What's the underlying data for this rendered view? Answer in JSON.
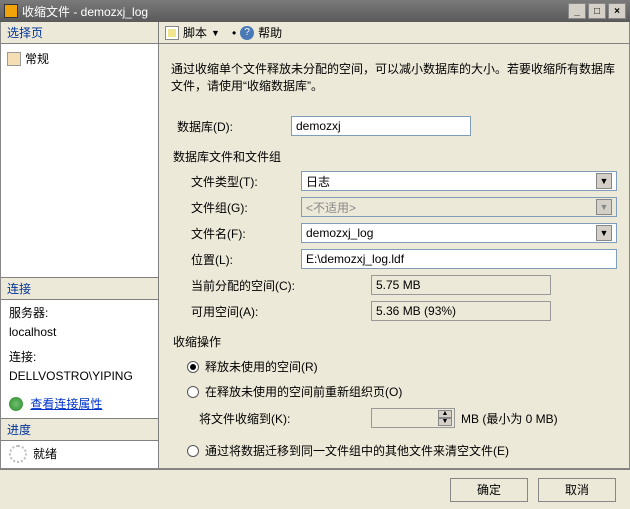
{
  "window": {
    "title": "收缩文件 - demozxj_log"
  },
  "titlebar_buttons": {
    "min": "_",
    "max": "□",
    "close": "×"
  },
  "left": {
    "select_page": "选择页",
    "general": "常规",
    "connection": "连接",
    "server_label": "服务器:",
    "server_value": "localhost",
    "conn_label": "连接:",
    "conn_value": "DELLVOSTRO\\YIPING",
    "view_props": "查看连接属性",
    "progress": "进度",
    "ready": "就绪"
  },
  "toolbar": {
    "script": "脚本",
    "help": "帮助"
  },
  "content": {
    "description": "通过收缩单个文件释放未分配的空间，可以减小数据库的大小。若要收缩所有数据库文件，请使用“收缩数据库”。",
    "db_label": "数据库(D):",
    "db_value": "demozxj",
    "group_header": "数据库文件和文件组",
    "filetype_label": "文件类型(T):",
    "filetype_value": "日志",
    "filegroup_label": "文件组(G):",
    "filegroup_value": "<不适用>",
    "filename_label": "文件名(F):",
    "filename_value": "demozxj_log",
    "location_label": "位置(L):",
    "location_value": "E:\\demozxj_log.ldf",
    "current_label": "当前分配的空间(C):",
    "current_value": "5.75 MB",
    "avail_label": "可用空间(A):",
    "avail_value": "5.36 MB (93%)",
    "shrink_header": "收缩操作",
    "radio1": "释放未使用的空间(R)",
    "radio2": "在释放未使用的空间前重新组织页(O)",
    "shrinkto_label": "将文件收缩到(K):",
    "shrinkto_suffix": "MB (最小为 0 MB)",
    "radio3": "通过将数据迁移到同一文件组中的其他文件来清空文件(E)"
  },
  "footer": {
    "ok": "确定",
    "cancel": "取消"
  }
}
